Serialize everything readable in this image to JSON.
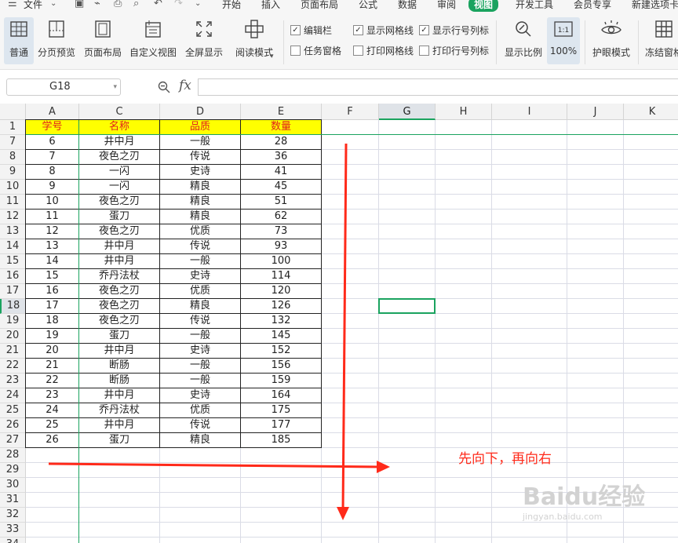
{
  "menu": {
    "items": [
      "文件",
      "开始",
      "插入",
      "页面布局",
      "公式",
      "数据",
      "审阅",
      "视图",
      "开发工具",
      "会员专享",
      "新建选项卡"
    ],
    "active": "视图"
  },
  "ribbon": {
    "buttons": [
      "普通",
      "分页预览",
      "页面布局",
      "自定义视图",
      "全屏显示",
      "阅读模式",
      "显示比例",
      "100%",
      "护眼模式",
      "冻结窗格"
    ],
    "checkboxes": [
      {
        "label": "编辑栏",
        "checked": true
      },
      {
        "label": "显示网格线",
        "checked": true
      },
      {
        "label": "显示行号列标",
        "checked": true
      },
      {
        "label": "任务窗格",
        "checked": false
      },
      {
        "label": "打印网格线",
        "checked": false
      },
      {
        "label": "打印行号列标",
        "checked": false
      }
    ]
  },
  "formula_bar": {
    "cell_ref": "G18",
    "fx": "fx",
    "value": ""
  },
  "sheet": {
    "columns": [
      "A",
      "C",
      "D",
      "E",
      "F",
      "G",
      "H",
      "I",
      "J",
      "K"
    ],
    "selected_col": "G",
    "selected_row": 18,
    "header_row": {
      "num": 1,
      "cells": [
        "学号",
        "名称",
        "品质",
        "数量"
      ]
    },
    "rows": [
      {
        "num": 7,
        "cells": [
          "6",
          "井中月",
          "一般",
          "28"
        ]
      },
      {
        "num": 8,
        "cells": [
          "7",
          "夜色之刃",
          "传说",
          "36"
        ]
      },
      {
        "num": 9,
        "cells": [
          "8",
          "一闪",
          "史诗",
          "41"
        ]
      },
      {
        "num": 10,
        "cells": [
          "9",
          "一闪",
          "精良",
          "45"
        ]
      },
      {
        "num": 11,
        "cells": [
          "10",
          "夜色之刃",
          "精良",
          "51"
        ]
      },
      {
        "num": 12,
        "cells": [
          "11",
          "蛋刀",
          "精良",
          "62"
        ]
      },
      {
        "num": 13,
        "cells": [
          "12",
          "夜色之刃",
          "优质",
          "73"
        ]
      },
      {
        "num": 14,
        "cells": [
          "13",
          "井中月",
          "传说",
          "93"
        ]
      },
      {
        "num": 15,
        "cells": [
          "14",
          "井中月",
          "一般",
          "100"
        ]
      },
      {
        "num": 16,
        "cells": [
          "15",
          "乔丹法杖",
          "史诗",
          "114"
        ]
      },
      {
        "num": 17,
        "cells": [
          "16",
          "夜色之刃",
          "优质",
          "120"
        ]
      },
      {
        "num": 18,
        "cells": [
          "17",
          "夜色之刃",
          "精良",
          "126"
        ]
      },
      {
        "num": 19,
        "cells": [
          "18",
          "夜色之刃",
          "传说",
          "132"
        ]
      },
      {
        "num": 20,
        "cells": [
          "19",
          "蛋刀",
          "一般",
          "145"
        ]
      },
      {
        "num": 21,
        "cells": [
          "20",
          "井中月",
          "史诗",
          "152"
        ]
      },
      {
        "num": 22,
        "cells": [
          "21",
          "断肠",
          "一般",
          "156"
        ]
      },
      {
        "num": 23,
        "cells": [
          "22",
          "断肠",
          "一般",
          "159"
        ]
      },
      {
        "num": 24,
        "cells": [
          "23",
          "井中月",
          "史诗",
          "164"
        ]
      },
      {
        "num": 25,
        "cells": [
          "24",
          "乔丹法杖",
          "优质",
          "175"
        ]
      },
      {
        "num": 26,
        "cells": [
          "25",
          "井中月",
          "传说",
          "177"
        ]
      },
      {
        "num": 27,
        "cells": [
          "26",
          "蛋刀",
          "精良",
          "185"
        ]
      }
    ],
    "empty_rows": [
      28,
      29,
      30,
      31,
      32,
      33,
      34
    ]
  },
  "annotation": "先向下，再向右",
  "watermark": {
    "line1": "Baidu经验",
    "line2": "jingyan.baidu.com"
  },
  "colors": {
    "accent": "#1aa35f",
    "header_fill": "#ffff00",
    "header_text": "#e0201c",
    "id_fill": "#bdd7ee",
    "arrow": "#ff2a1a"
  }
}
